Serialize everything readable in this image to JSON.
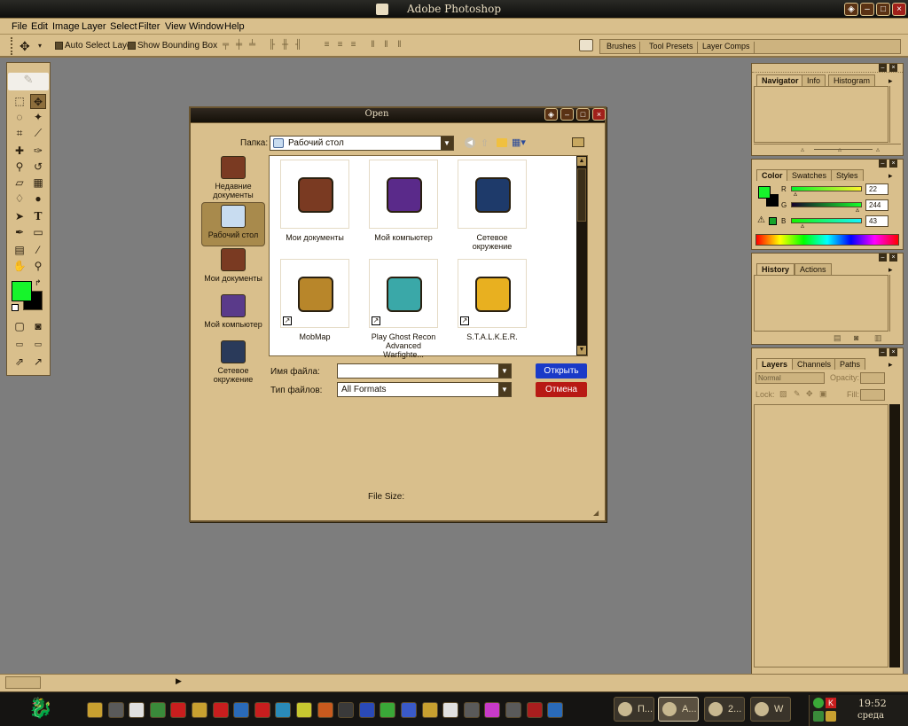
{
  "app": {
    "title": "Adobe Photoshop"
  },
  "menu": [
    "File",
    "Edit",
    "Image",
    "Layer",
    "Select",
    "Filter",
    "View",
    "Window",
    "Help"
  ],
  "options": {
    "auto_select_layer": "Auto Select Layer",
    "show_bounding_box": "Show Bounding Box"
  },
  "palette_well": {
    "tabs": [
      "Brushes",
      "Tool Presets",
      "Layer Comps"
    ]
  },
  "dialog": {
    "title": "Open",
    "folder_label": "Папка:",
    "folder_value": "Рабочий стол",
    "places": [
      {
        "label": "Недавние документы",
        "icon": "recent-documents-icon",
        "color": "#7a3a22"
      },
      {
        "label": "Рабочий стол",
        "icon": "desktop-icon",
        "color": "#c8dcf0"
      },
      {
        "label": "Мои документы",
        "icon": "my-documents-icon",
        "color": "#7a3a22"
      },
      {
        "label": "Мой компьютер",
        "icon": "my-computer-icon",
        "color": "#5a3a8a"
      },
      {
        "label": "Сетевое окружение",
        "icon": "network-icon",
        "color": "#2a3a5a"
      }
    ],
    "files": [
      {
        "name": "Мои документы",
        "icon": "my-documents-icon",
        "color": "#7a3a22",
        "shortcut": false
      },
      {
        "name": "Мой компьютер",
        "icon": "my-computer-icon",
        "color": "#5a2a8a",
        "shortcut": false
      },
      {
        "name": "Сетевое окружение",
        "icon": "network-icon",
        "color": "#1e3a6a",
        "shortcut": false
      },
      {
        "name": "MobMap",
        "icon": "world-of-warcraft-icon",
        "color": "#b8862a",
        "shortcut": true
      },
      {
        "name": "Play Ghost Recon Advanced Warfighte...",
        "icon": "ghost-recon-icon",
        "color": "#3aa8a8",
        "shortcut": true
      },
      {
        "name": "S.T.A.L.K.E.R.",
        "icon": "radiation-icon",
        "color": "#e8b020",
        "shortcut": true
      }
    ],
    "filename_label": "Имя файла:",
    "filename_value": "",
    "filetype_label": "Тип файлов:",
    "filetype_value": "All Formats",
    "open_button": "Открыть",
    "cancel_button": "Отмена",
    "file_size": "File Size:"
  },
  "navigator": {
    "tabs": [
      "Navigator",
      "Info",
      "Histogram"
    ]
  },
  "color": {
    "tabs": [
      "Color",
      "Swatches",
      "Styles"
    ],
    "r_label": "R",
    "g_label": "G",
    "b_label": "B",
    "r": "22",
    "g": "244",
    "b": "43",
    "fg_color": "#16f42b"
  },
  "history": {
    "tabs": [
      "History",
      "Actions"
    ]
  },
  "layers": {
    "tabs": [
      "Layers",
      "Channels",
      "Paths"
    ],
    "blend_mode": "Normal",
    "opacity_label": "Opacity:",
    "lock_label": "Lock:",
    "fill_label": "Fill:"
  },
  "taskbar": {
    "tasks": [
      {
        "label": "П..."
      },
      {
        "label": "A..."
      },
      {
        "label": "2..."
      },
      {
        "label": "W"
      }
    ],
    "time": "19:52",
    "day": "среда"
  }
}
